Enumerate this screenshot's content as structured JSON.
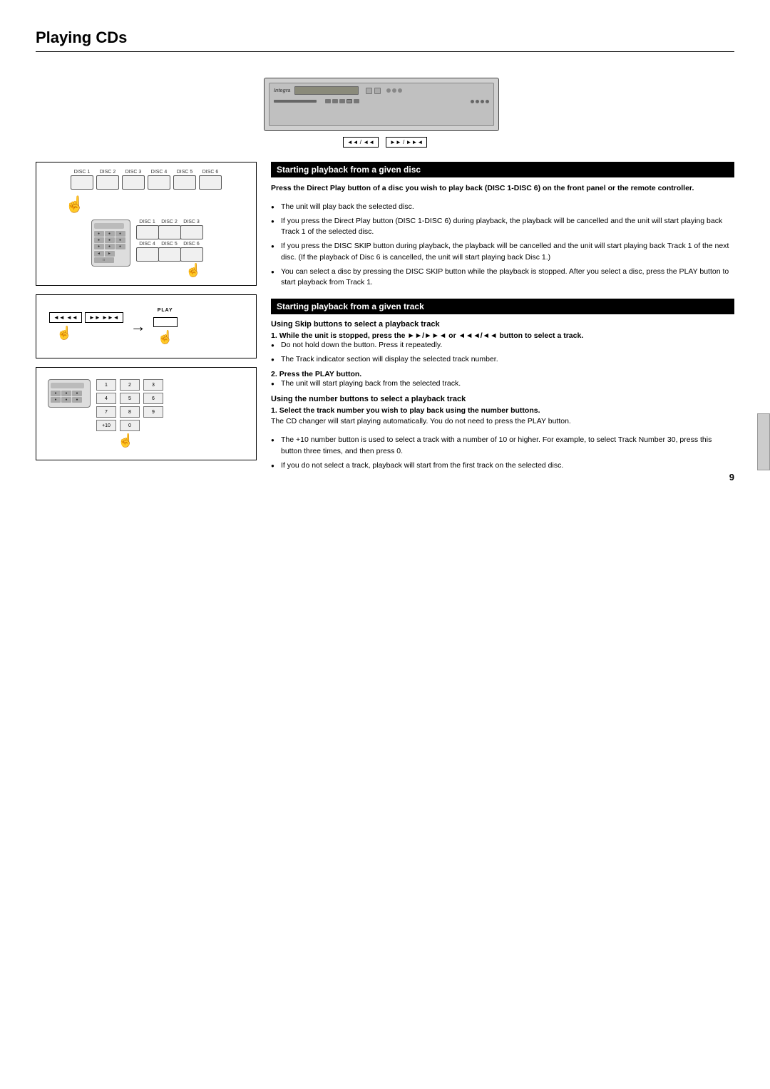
{
  "page": {
    "title": "Playing CDs",
    "number": "9"
  },
  "top_diagram": {
    "play_label": "PLAY",
    "skip_labels": {
      "left": "◄◄ / ◄◄",
      "right": "►► / ►►◄"
    }
  },
  "section_disc": {
    "header": "Starting playback from a given disc",
    "bold_text": "Press the Direct Play button of a disc you wish to play back (DISC 1-DISC 6) on the front panel or the remote controller.",
    "bullets": [
      "The unit will play back the selected disc.",
      "If you press the Direct Play button (DISC 1-DISC 6) during playback, the playback will be cancelled and the unit will start playing back Track 1 of the selected disc.",
      "If you press the DISC SKIP button during playback, the playback will be cancelled and the unit will start playing back Track 1 of the next disc. (If the playback of Disc 6 is cancelled, the unit will start playing back Disc 1.)",
      "You can select a disc by pressing the DISC SKIP button while the playback is stopped. After you select a disc, press the PLAY button to start playback from Track 1."
    ]
  },
  "section_track": {
    "header": "Starting playback from a given track",
    "subsection_skip": {
      "title": "Using Skip buttons to select a playback track",
      "numbered": [
        {
          "num": "1.",
          "bold": "While the unit is stopped, press the ►►/►►◄ or ◄◄◄/◄◄ button to select a track.",
          "bullets": [
            "Do not hold down the button. Press it repeatedly.",
            "The Track indicator section will display the selected track number."
          ]
        },
        {
          "num": "2.",
          "bold": "Press the PLAY button.",
          "bullets": [
            "The unit will start playing back from the selected track."
          ]
        }
      ]
    },
    "subsection_number": {
      "title": "Using the number buttons to select a playback track",
      "numbered": [
        {
          "num": "1.",
          "bold": "Select the track number you wish to play back using the number buttons.",
          "text": "The CD changer will start playing automatically. You do not need to press the PLAY button.",
          "bullets": [
            "The +10 number button is used to select a track with a number of 10 or higher. For example, to select Track Number 30, press this button three times, and then press 0.",
            "If you do not select a track, playback will start from the first track on the selected disc."
          ]
        }
      ]
    }
  },
  "disc_labels": [
    "DISC 1",
    "DISC 2",
    "DISC 3",
    "DISC 4",
    "DISC 5",
    "DISC 6"
  ],
  "num_buttons": [
    "1",
    "2",
    "3",
    "4",
    "5",
    "6",
    "7",
    "8",
    "9",
    "+10",
    "0"
  ],
  "play_label_diagram": "PLAY"
}
